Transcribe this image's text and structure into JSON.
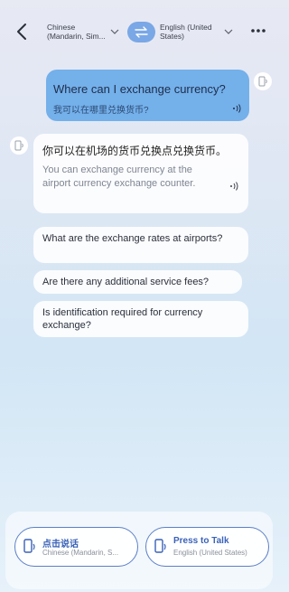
{
  "header": {
    "source_language": "Chinese (Mandarin, Sim...",
    "target_language": "English (United States)"
  },
  "conversation": {
    "my_message": {
      "text": "Where can I exchange currency?",
      "translation": "我可以在哪里兑换货币?"
    },
    "their_message": {
      "text": "你可以在机场的货币兑换点兑换货币。",
      "translation": "You can exchange currency at the airport currency exchange counter."
    },
    "suggestions": [
      "What are the exchange rates at airports?",
      "Are there any additional service fees?",
      "Is identification required for currency exchange?"
    ]
  },
  "talk_buttons": {
    "left": {
      "label": "点击说话",
      "language": "Chinese (Mandarin, S..."
    },
    "right": {
      "label": "Press to Talk",
      "language": "English (United States)"
    }
  },
  "colors": {
    "accent": "#74b0ea",
    "button_border": "#5b7fc8",
    "button_text": "#3a62b8"
  },
  "icons": [
    "back-arrow-icon",
    "chevron-down-icon",
    "swap-icon",
    "more-icon",
    "speaker-icon",
    "device-mic-icon"
  ]
}
